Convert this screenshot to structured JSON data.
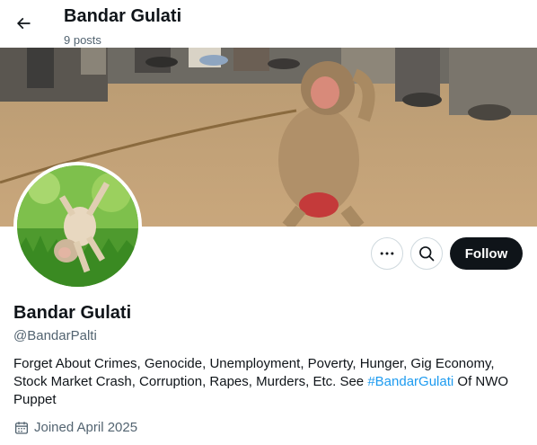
{
  "header": {
    "title": "Bandar Gulati",
    "post_count": "9 posts"
  },
  "profile": {
    "display_name": "Bandar Gulati",
    "handle": "@BandarPalti",
    "bio_before": "Forget About Crimes, Genocide, Unemployment, Poverty, Hunger, Gig Economy, Stock Market Crash, Corruption, Rapes, Murders, Etc. See ",
    "bio_hashtag": "#BandarGulati",
    "bio_after": " Of NWO Puppet",
    "joined": "Joined April 2025"
  },
  "actions": {
    "follow_label": "Follow"
  },
  "icons": {
    "back": "arrow-left-icon",
    "more": "more-horizontal-icon",
    "search": "search-icon",
    "calendar": "calendar-icon"
  },
  "colors": {
    "accent": "#1d9bf0",
    "text": "#0f1419",
    "secondary": "#536471",
    "follow_bg": "#0f1419",
    "border": "#cfd9de"
  }
}
